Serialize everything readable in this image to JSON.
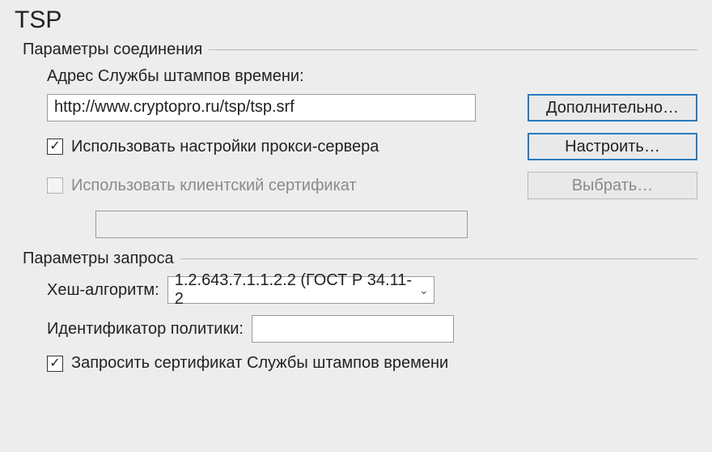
{
  "title": "TSP",
  "connection": {
    "legend": "Параметры соединения",
    "address_label": "Адрес Службы штампов времени:",
    "address_value": "http://www.cryptopro.ru/tsp/tsp.srf",
    "advanced_button": "Дополнительно…",
    "use_proxy_label": "Использовать настройки прокси-сервера",
    "use_proxy_checked": "✓",
    "configure_button": "Настроить…",
    "use_client_cert_label": "Использовать клиентский сертификат",
    "select_button": "Выбрать…",
    "client_cert_value": ""
  },
  "request": {
    "legend": "Параметры запроса",
    "hash_label": "Хеш-алгоритм:",
    "hash_value": "1.2.643.7.1.1.2.2 (ГОСТ Р 34.11-2",
    "policy_label": "Идентификатор политики:",
    "policy_value": "",
    "request_cert_label": "Запросить сертификат Службы штампов времени",
    "request_cert_checked": "✓"
  }
}
